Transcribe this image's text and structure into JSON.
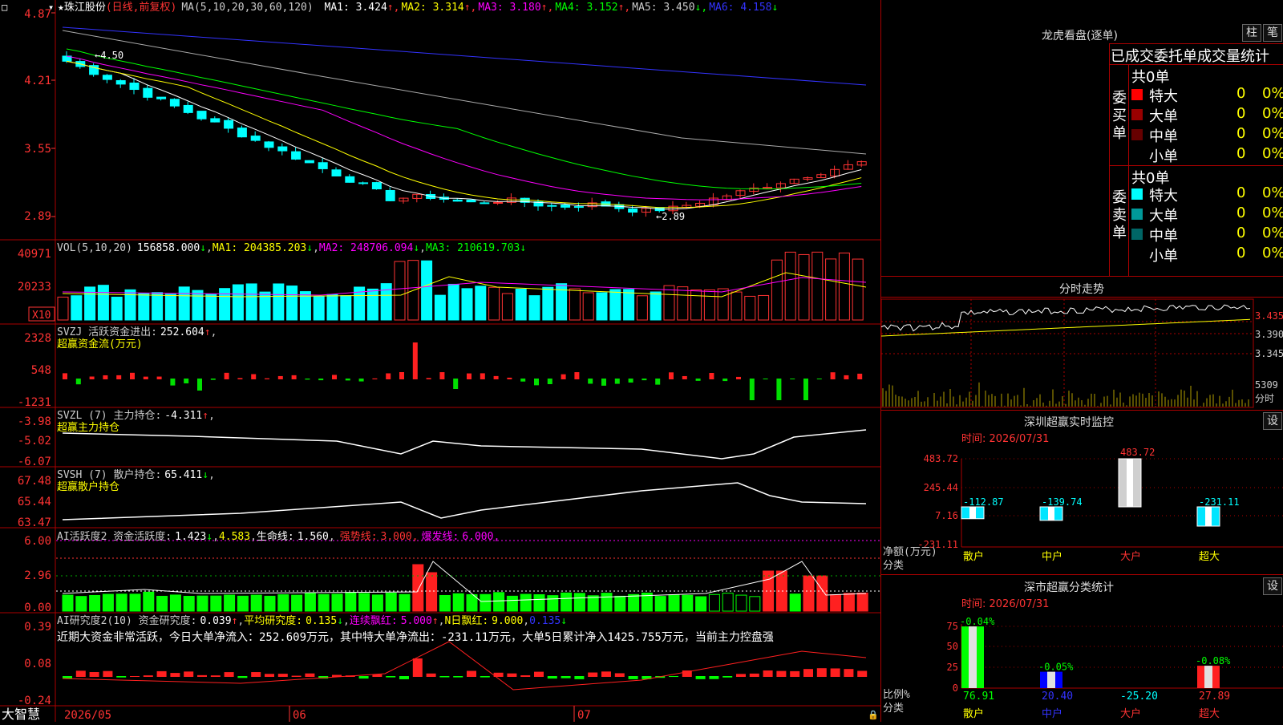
{
  "stock": {
    "name": "★珠江股份",
    "period": "(日线,前复权)",
    "ma_label": "MA(5,10,20,30,60,120)",
    "ma_values": [
      {
        "label": "MA1:",
        "value": "3.424",
        "arrow": "↑",
        "color": "#ffffff"
      },
      {
        "label": "MA2:",
        "value": "3.314",
        "arrow": "↑",
        "color": "#ffff00"
      },
      {
        "label": "MA3:",
        "value": "3.180",
        "arrow": "↑",
        "color": "#ff00ff"
      },
      {
        "label": "MA4:",
        "value": "3.152",
        "arrow": "↑",
        "color": "#00ff00"
      },
      {
        "label": "MA5:",
        "value": "3.450",
        "arrow": "↓",
        "color": "#cccccc"
      },
      {
        "label": "MA6:",
        "value": "4.158",
        "arrow": "↓",
        "color": "#3333ff"
      }
    ],
    "price_axis": [
      "4.87",
      "4.21",
      "3.55",
      "2.89"
    ],
    "high_mark": "4.50",
    "low_mark": "←2.89"
  },
  "vol": {
    "label": "VOL(5,10,20)",
    "value": "156858.000",
    "arrow": "↓",
    "ma": [
      {
        "label": "MA1:",
        "value": "204385.203",
        "arrow": "↓",
        "color": "#ffff00"
      },
      {
        "label": "MA2:",
        "value": "248706.094",
        "arrow": "↓",
        "color": "#ff00ff"
      },
      {
        "label": "MA3:",
        "value": "210619.703",
        "arrow": "↓",
        "color": "#00ff00"
      }
    ],
    "axis": [
      "40971",
      "20233"
    ],
    "unit": "X10"
  },
  "svzj": {
    "label": "SVZJ  活跃资金进出:",
    "value": "252.604",
    "arrow": "↑",
    "tail": ",",
    "sub": "超赢资金流(万元)",
    "axis": [
      "2328",
      "548",
      "-1231"
    ]
  },
  "svzl": {
    "label": "SVZL (7) 主力持仓:",
    "value": "-4.311",
    "arrow": "↑",
    "tail": ",",
    "sub": "超赢主力持仓",
    "axis": [
      "-3.98",
      "-5.02",
      "-6.07"
    ]
  },
  "svsh": {
    "label": "SVSH (7) 散户持仓:",
    "value": "65.411",
    "arrow": "↓",
    "tail": ",",
    "sub": "超赢散户持仓",
    "axis": [
      "67.48",
      "65.44",
      "63.47"
    ]
  },
  "ai_active": {
    "label": "AI活跃度2 资金活跃度:",
    "v1": "1.423",
    "a1": "↓",
    "tail1": ",",
    "v2": "4.583",
    "tail2": ",",
    "life": "生命线:",
    "v3": "1.560",
    "tail3": ",",
    "strong": "强势线:",
    "v4": "3.000",
    "tail4": ",",
    "burst": "爆发线:",
    "v5": "6.000",
    "tail5": ",",
    "axis": [
      "6.00",
      "2.96",
      "0.00"
    ]
  },
  "ai_research": {
    "label": "AI研究度2(10) 资金研究度:",
    "v1": "0.039",
    "a1": "↑",
    "tail1": ",",
    "avg": "平均研究度:",
    "v2": "0.135",
    "a2": "↓",
    "tail2": ",",
    "red": "连续飘红:",
    "v3": "5.000",
    "a3": "↑",
    "tail3": ",",
    "nred": "N日飘红:",
    "v4": "9.000",
    "tail4": ",",
    "v5": "0.135",
    "a5": "↓",
    "text": "近期大资金非常活跃，今日大单净流入：252.609万元，其中特大单净流出：-231.11万元，大单5日累计净入1425.755万元，当前主力控盘强",
    "axis": [
      "0.39",
      "0.08",
      "-0.24"
    ]
  },
  "time_axis": {
    "brand": "大智慧",
    "labels": [
      "2026/05",
      "06",
      "07"
    ]
  },
  "lhb": {
    "title": "龙虎看盘(逐单)",
    "btn1": "柱",
    "btn2": "笔",
    "subtitle": "已成交委托单成交量统计",
    "buy_group": "委买单",
    "sell_group": "委卖单",
    "buy_total": "共0单",
    "sell_total": "共0单",
    "buy_rows": [
      {
        "name": "特大",
        "count": "0",
        "pct": "0%",
        "color": "#ff0000"
      },
      {
        "name": "大单",
        "count": "0",
        "pct": "0%",
        "color": "#990000"
      },
      {
        "name": "中单",
        "count": "0",
        "pct": "0%",
        "color": "#660000"
      },
      {
        "name": "小单",
        "count": "0",
        "pct": "0%",
        "color": "#000000"
      }
    ],
    "sell_rows": [
      {
        "name": "特大",
        "count": "0",
        "pct": "0%",
        "color": "#00ffff"
      },
      {
        "name": "大单",
        "count": "0",
        "pct": "0%",
        "color": "#009999"
      },
      {
        "name": "中单",
        "count": "0",
        "pct": "0%",
        "color": "#006666"
      },
      {
        "name": "小单",
        "count": "0",
        "pct": "0%",
        "color": "#000000"
      }
    ]
  },
  "intraday": {
    "title": "分时走势",
    "axis": [
      "3.435",
      "3.390",
      "3.345"
    ],
    "vol_axis": "5309",
    "vol_unit": "分时"
  },
  "sz_monitor": {
    "title": "深圳超赢实时监控",
    "btn": "设",
    "time": "时间: 2026/07/31",
    "axis": [
      "483.72",
      "245.44",
      "7.16",
      "-231.11"
    ],
    "ylabel1": "净额(万元)",
    "ylabel2": "分类",
    "categories": [
      "散户",
      "中户",
      "大户",
      "超大"
    ],
    "values": [
      "-112.87",
      "-139.74",
      "483.72",
      "-231.11"
    ]
  },
  "sz_class": {
    "title": "深市超赢分类统计",
    "btn": "设",
    "time": "时间: 2026/07/31",
    "axis": [
      "75",
      "50",
      "25",
      "0"
    ],
    "ylabel1": "比例%",
    "ylabel2": "分类",
    "categories": [
      "散户",
      "中户",
      "大户",
      "超大"
    ],
    "top_values": [
      "-0.04%",
      "",
      "",
      "-0.08%"
    ],
    "mid_value": "-0.05%",
    "bottom_values": [
      "76.91",
      "20.40",
      "-25.20",
      "27.89"
    ]
  },
  "chart_data": {
    "type": "bar",
    "title": "珠江股份",
    "categories": [
      "散户",
      "中户",
      "大户",
      "超大"
    ],
    "series": [
      {
        "name": "净额(万元)",
        "values": [
          -112.87,
          -139.74,
          483.72,
          -231.11
        ]
      },
      {
        "name": "比例%",
        "values": [
          76.91,
          20.4,
          -25.2,
          27.89
        ]
      }
    ],
    "ylim": [
      -231.11,
      483.72
    ]
  }
}
